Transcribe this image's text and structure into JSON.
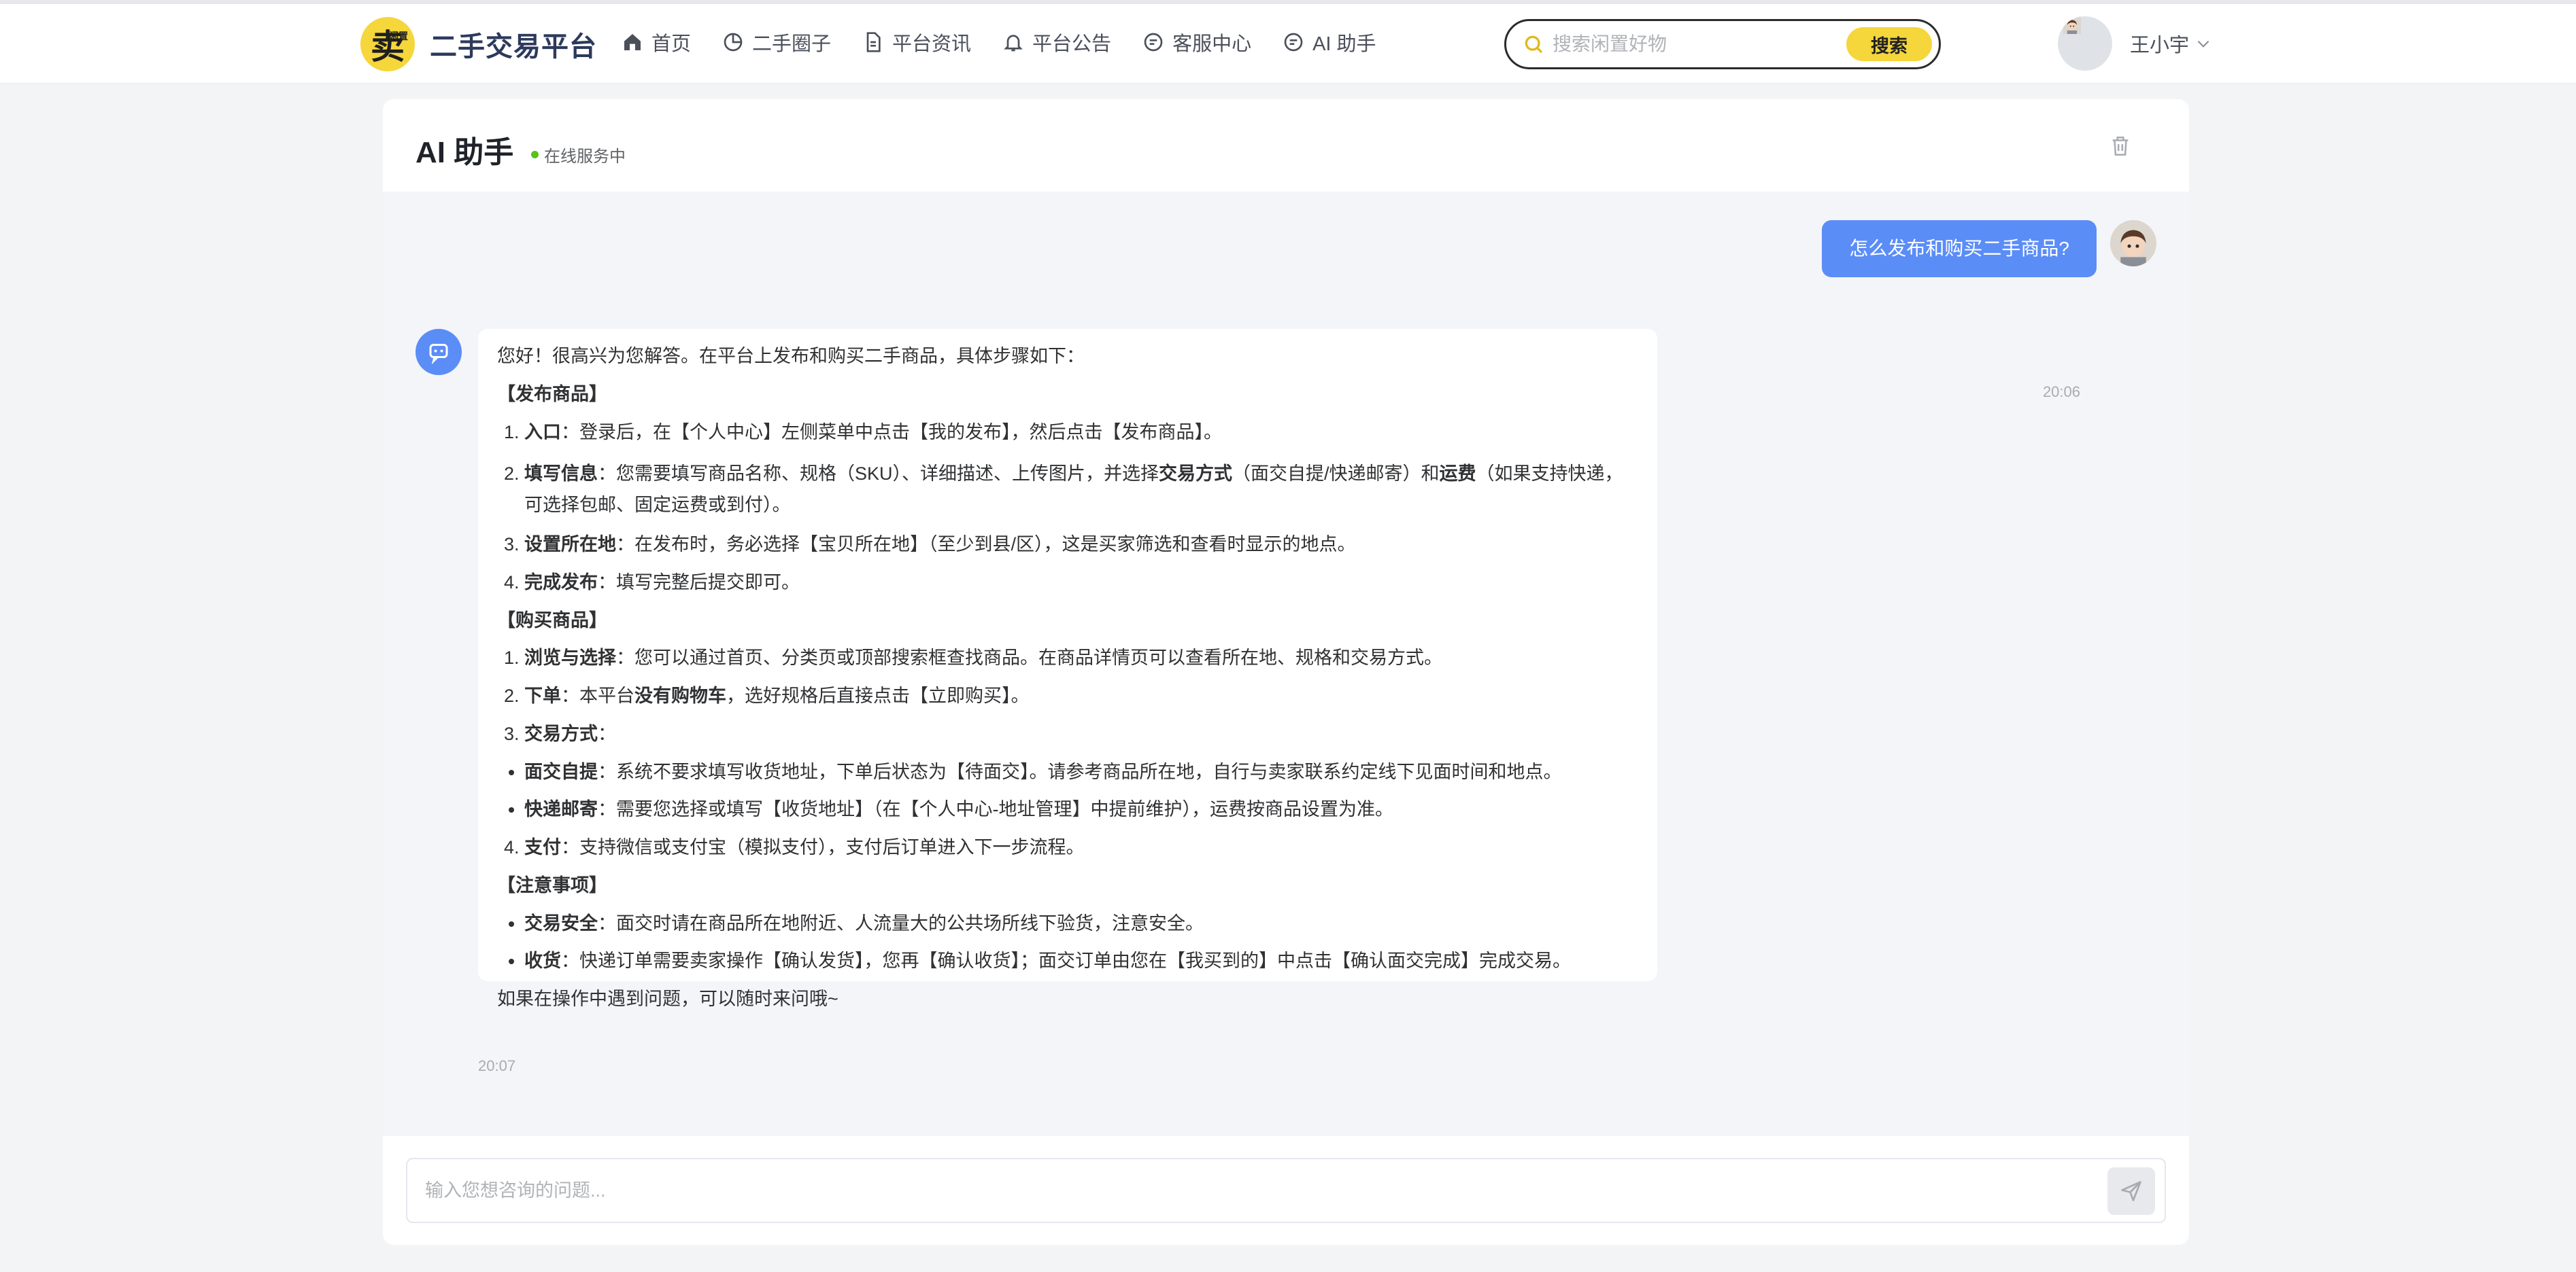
{
  "header": {
    "logo_char": "卖",
    "logo_sub": "闲置",
    "app_name": "二手交易平台",
    "nav": [
      {
        "label": "首页",
        "icon": "home-icon"
      },
      {
        "label": "二手圈子",
        "icon": "pie-chart-icon"
      },
      {
        "label": "平台资讯",
        "icon": "document-icon"
      },
      {
        "label": "平台公告",
        "icon": "bell-icon"
      },
      {
        "label": "客服中心",
        "icon": "chat-bubble-icon"
      },
      {
        "label": "AI 助手",
        "icon": "chat-bubble-icon"
      }
    ],
    "search_placeholder": "搜索闲置好物",
    "search_button": "搜索",
    "user_name": "王小宇"
  },
  "chat": {
    "title": "AI 助手",
    "status": "在线服务中",
    "user_message": "怎么发布和购买二手商品?",
    "user_time": "20:06",
    "bot_time": "20:07",
    "bot_reply": {
      "intro": "您好！很高兴为您解答。在平台上发布和购买二手商品，具体步骤如下：",
      "publish_title": "【发布商品】",
      "publish_steps": [
        {
          "term": "入口",
          "text": "：登录后，在【个人中心】左侧菜单中点击【我的发布】，然后点击【发布商品】。"
        },
        {
          "term": "填写信息",
          "text_a": "：您需要填写商品名称、规格（SKU）、详细描述、上传图片，并选择",
          "bold_a": "交易方式",
          "text_b": "（面交自提/快递邮寄）和",
          "bold_b": "运费",
          "text_c": "（如果支持快递，可选择包邮、固定运费或到付）。"
        },
        {
          "term": "设置所在地",
          "text": "：在发布时，务必选择【宝贝所在地】（至少到县/区），这是买家筛选和查看时显示的地点。"
        },
        {
          "term": "完成发布",
          "text": "：填写完整后提交即可。"
        }
      ],
      "buy_title": "【购买商品】",
      "buy_steps": [
        {
          "term": "浏览与选择",
          "text": "：您可以通过首页、分类页或顶部搜索框查找商品。在商品详情页可以查看所在地、规格和交易方式。"
        },
        {
          "term": "下单",
          "text_a": "：本平台",
          "bold_a": "没有购物车",
          "text_b": "，选好规格后直接点击【立即购买】。"
        },
        {
          "term": "交易方式",
          "text": "："
        }
      ],
      "trade_methods": [
        {
          "term": "面交自提",
          "text": "：系统不要求填写收货地址，下单后状态为【待面交】。请参考商品所在地，自行与卖家联系约定线下见面时间和地点。"
        },
        {
          "term": "快递邮寄",
          "text": "：需要您选择或填写【收货地址】（在【个人中心-地址管理】中提前维护），运费按商品设置为准。"
        }
      ],
      "pay_step": {
        "term": "支付",
        "text": "：支持微信或支付宝（模拟支付），支付后订单进入下一步流程。"
      },
      "notes_title": "【注意事项】",
      "notes": [
        {
          "term": "交易安全",
          "text": "：面交时请在商品所在地附近、人流量大的公共场所线下验货，注意安全。"
        },
        {
          "term": "收货",
          "text": "：快递订单需要卖家操作【确认发货】，您再【确认收货】；面交订单由您在【我买到的】中点击【确认面交完成】完成交易。"
        }
      ],
      "closing": "如果在操作中遇到问题，可以随时来问哦~"
    },
    "input_placeholder": "输入您想咨询的问题..."
  },
  "colors": {
    "brand_yellow": "#f5d63b",
    "accent_blue": "#5b8df7",
    "online_green": "#52c41a"
  }
}
